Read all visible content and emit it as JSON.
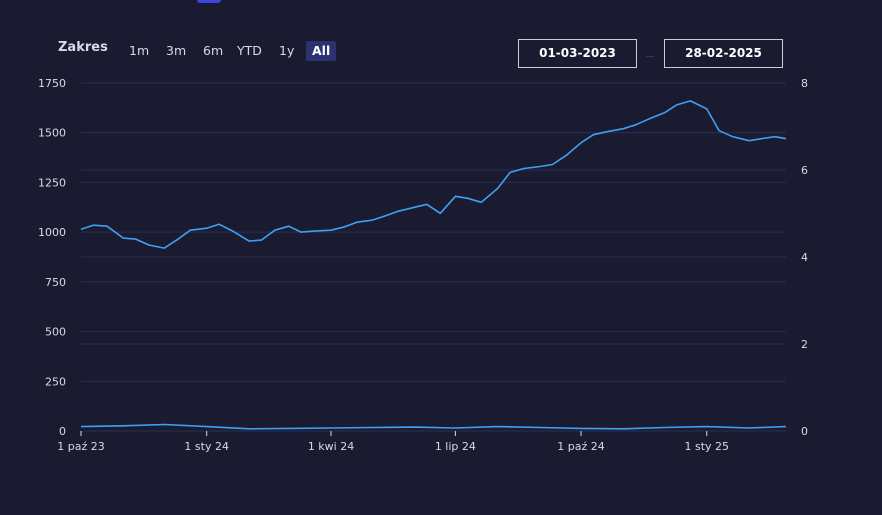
{
  "controls": {
    "range_label": "Zakres",
    "range_buttons": [
      "1m",
      "3m",
      "6m",
      "YTD",
      "1y",
      "All"
    ],
    "active_range": "All",
    "date_from": "01-03-2023",
    "date_to": "28-02-2025"
  },
  "colors": {
    "background": "#1a1b30",
    "grid": "#2b2e55",
    "line": "#3fa0f2",
    "active_button": "#2c3170"
  },
  "chart_data": {
    "type": "line",
    "title": "",
    "xlabel": "",
    "ylabel": "",
    "x_tick_labels": [
      "1 paź 23",
      "1 sty 24",
      "1 kwi 24",
      "1 lip 24",
      "1 paź 24",
      "1 sty 25"
    ],
    "x_tick_dates": [
      "2023-10-01",
      "2024-01-01",
      "2024-04-01",
      "2024-07-01",
      "2024-10-01",
      "2025-01-01"
    ],
    "xlim": [
      "2023-10-01",
      "2025-02-28"
    ],
    "y_left": {
      "ticks": [
        0,
        250,
        500,
        750,
        1000,
        1250,
        1500,
        1750
      ],
      "ylim": [
        0,
        1750
      ]
    },
    "y_right": {
      "ticks": [
        0,
        2,
        4,
        6,
        8
      ],
      "ylim": [
        0,
        8
      ]
    },
    "grid": true,
    "legend": "none",
    "series": [
      {
        "axis": "left",
        "x": [
          "2023-10-01",
          "2023-10-10",
          "2023-10-20",
          "2023-11-01",
          "2023-11-10",
          "2023-11-20",
          "2023-12-01",
          "2023-12-10",
          "2023-12-20",
          "2024-01-01",
          "2024-01-10",
          "2024-01-20",
          "2024-02-01",
          "2024-02-10",
          "2024-02-20",
          "2024-03-01",
          "2024-03-10",
          "2024-03-20",
          "2024-04-01",
          "2024-04-10",
          "2024-04-20",
          "2024-05-01",
          "2024-05-10",
          "2024-05-20",
          "2024-06-01",
          "2024-06-10",
          "2024-06-20",
          "2024-07-01",
          "2024-07-10",
          "2024-07-20",
          "2024-08-01",
          "2024-08-10",
          "2024-08-20",
          "2024-09-01",
          "2024-09-10",
          "2024-09-20",
          "2024-10-01",
          "2024-10-10",
          "2024-10-20",
          "2024-11-01",
          "2024-11-10",
          "2024-11-20",
          "2024-12-01",
          "2024-12-10",
          "2024-12-20",
          "2025-01-01",
          "2025-01-10",
          "2025-01-20",
          "2025-02-01",
          "2025-02-10",
          "2025-02-20",
          "2025-02-28"
        ],
        "values": [
          1015,
          1035,
          1030,
          970,
          965,
          935,
          920,
          960,
          1010,
          1020,
          1040,
          1005,
          955,
          960,
          1010,
          1030,
          1000,
          1005,
          1010,
          1025,
          1050,
          1060,
          1080,
          1105,
          1125,
          1140,
          1095,
          1180,
          1170,
          1150,
          1220,
          1300,
          1320,
          1330,
          1340,
          1385,
          1450,
          1490,
          1505,
          1520,
          1540,
          1570,
          1600,
          1640,
          1660,
          1620,
          1510,
          1480,
          1460,
          1470,
          1480,
          1470
        ]
      },
      {
        "axis": "right",
        "x": [
          "2023-10-01",
          "2023-11-01",
          "2023-12-01",
          "2024-01-01",
          "2024-02-01",
          "2024-03-01",
          "2024-04-01",
          "2024-05-01",
          "2024-06-01",
          "2024-07-01",
          "2024-08-01",
          "2024-09-01",
          "2024-10-01",
          "2024-11-01",
          "2024-12-01",
          "2025-01-01",
          "2025-02-01",
          "2025-02-28"
        ],
        "values": [
          0.1,
          0.12,
          0.15,
          0.1,
          0.05,
          0.06,
          0.07,
          0.08,
          0.09,
          0.07,
          0.1,
          0.08,
          0.06,
          0.05,
          0.08,
          0.1,
          0.07,
          0.1
        ]
      }
    ]
  }
}
